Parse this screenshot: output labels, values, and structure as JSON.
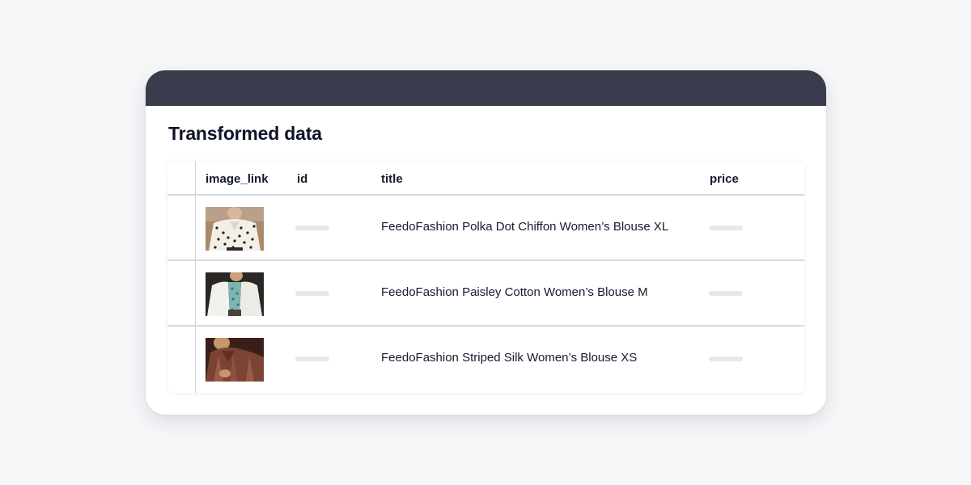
{
  "heading": "Transformed data",
  "table": {
    "columns": [
      "image_link",
      "id",
      "title",
      "price"
    ],
    "rows": [
      {
        "image": "polka-dot-blouse-photo",
        "title": "FeedoFashion Polka Dot Chiffon Women’s Blouse XL"
      },
      {
        "image": "paisley-blouse-photo",
        "title": "FeedoFashion Paisley Cotton Women’s Blouse M"
      },
      {
        "image": "striped-silk-blouse-photo",
        "title": "FeedoFashion Striped Silk Women’s Blouse XS"
      }
    ]
  },
  "colors": {
    "titlebar": "#3a3c4d",
    "background": "#f6f7f9",
    "placeholder": "#e6e8ed"
  }
}
